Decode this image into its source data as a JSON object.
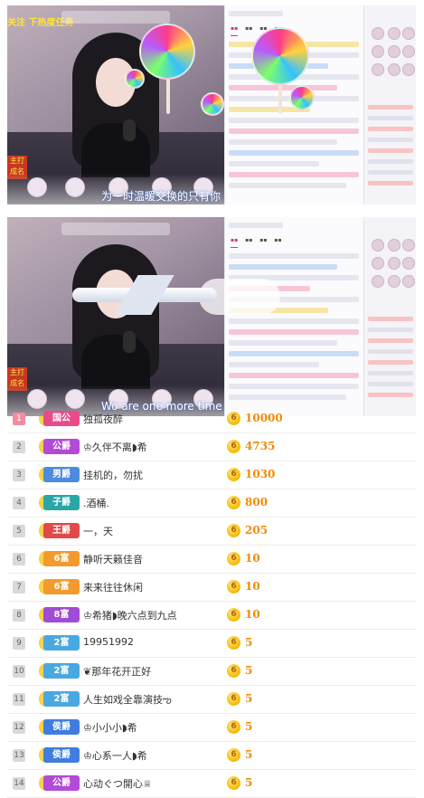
{
  "screens": [
    {
      "alert": "关注 下热度任务",
      "caption": "为一时温暖交换的只有你",
      "left_badge": "主打 成名"
    },
    {
      "caption": "Wo are one more time",
      "left_badge": "主打 成名"
    }
  ],
  "ranking": {
    "rows": [
      {
        "rank": "1",
        "title": "国公",
        "title_color": "#e94b8a",
        "name": "独孤夜醉",
        "amount": "10000"
      },
      {
        "rank": "2",
        "title": "公爵",
        "title_color": "#b34ad8",
        "name": "♔久伴不离◗希",
        "amount": "4735"
      },
      {
        "rank": "3",
        "title": "男爵",
        "title_color": "#4c8be0",
        "name": "挂机的，勿扰",
        "amount": "1030"
      },
      {
        "rank": "4",
        "title": "子爵",
        "title_color": "#2ba6a6",
        "name": ".酒桶.",
        "amount": "800"
      },
      {
        "rank": "5",
        "title": "王爵",
        "title_color": "#e24a4a",
        "name": "一，天",
        "amount": "205"
      },
      {
        "rank": "6",
        "title": "6富",
        "title_color": "#f39a2e",
        "name": "静听天籁佳音",
        "amount": "10"
      },
      {
        "rank": "7",
        "title": "6富",
        "title_color": "#f39a2e",
        "name": "来来往往休闲",
        "amount": "10"
      },
      {
        "rank": "8",
        "title": "8富",
        "title_color": "#a04bd6",
        "name": "♔希猪◗晚六点到九点",
        "amount": "10"
      },
      {
        "rank": "9",
        "title": "2富",
        "title_color": "#4aa8e0",
        "name": "19951992",
        "amount": "5"
      },
      {
        "rank": "10",
        "title": "2富",
        "title_color": "#4aa8e0",
        "name": "❦那年花开正好",
        "amount": "5"
      },
      {
        "rank": "11",
        "title": "2富",
        "title_color": "#4aa8e0",
        "name": "人生如戏全靠演技ఌ",
        "amount": "5"
      },
      {
        "rank": "12",
        "title": "侯爵",
        "title_color": "#3f7ee0",
        "name": "♔小小小◗希",
        "amount": "5"
      },
      {
        "rank": "13",
        "title": "侯爵",
        "title_color": "#3f7ee0",
        "name": "♔心系一人◗希",
        "amount": "5"
      },
      {
        "rank": "14",
        "title": "公爵",
        "title_color": "#b34ad8",
        "name": "心动ぐつ開心♕",
        "amount": "5"
      }
    ]
  },
  "coin_symbol": "6",
  "colors": {
    "accent": "#f28a00",
    "rank_first": "#f28da1"
  }
}
